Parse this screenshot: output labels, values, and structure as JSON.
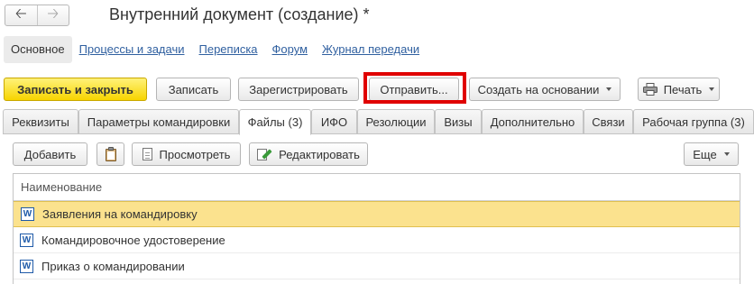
{
  "window": {
    "title": "Внутренний документ (создание) *",
    "nav_back_icon": "arrow-left-icon",
    "nav_forward_icon": "arrow-right-icon"
  },
  "sections": [
    {
      "label": "Основное",
      "active": true
    },
    {
      "label": "Процессы и задачи"
    },
    {
      "label": "Переписка"
    },
    {
      "label": "Форум"
    },
    {
      "label": "Журнал передачи"
    }
  ],
  "toolbar": {
    "save_close": "Записать и закрыть",
    "save": "Записать",
    "register": "Зарегистрировать",
    "send": "Отправить...",
    "create_based": "Создать на основании",
    "print": "Печать",
    "highlight_color": "#e00000",
    "primary_color": "#f7d400"
  },
  "tabs": [
    {
      "label": "Реквизиты"
    },
    {
      "label": "Параметры командировки"
    },
    {
      "label": "Файлы (3)",
      "active": true
    },
    {
      "label": "ИФО"
    },
    {
      "label": "Резолюции"
    },
    {
      "label": "Визы"
    },
    {
      "label": "Дополнительно"
    },
    {
      "label": "Связи"
    },
    {
      "label": "Рабочая группа (3)"
    }
  ],
  "files_toolbar": {
    "add": "Добавить",
    "view": "Просмотреть",
    "edit": "Редактировать",
    "more": "Еще"
  },
  "files_table": {
    "header": "Наименование",
    "file_icon_letter": "W",
    "rows": [
      {
        "name": "Заявления на командировку",
        "selected": true
      },
      {
        "name": "Командировочное удостоверение"
      },
      {
        "name": "Приказ о командировании"
      }
    ],
    "selected_row_color": "#fbe28e"
  }
}
